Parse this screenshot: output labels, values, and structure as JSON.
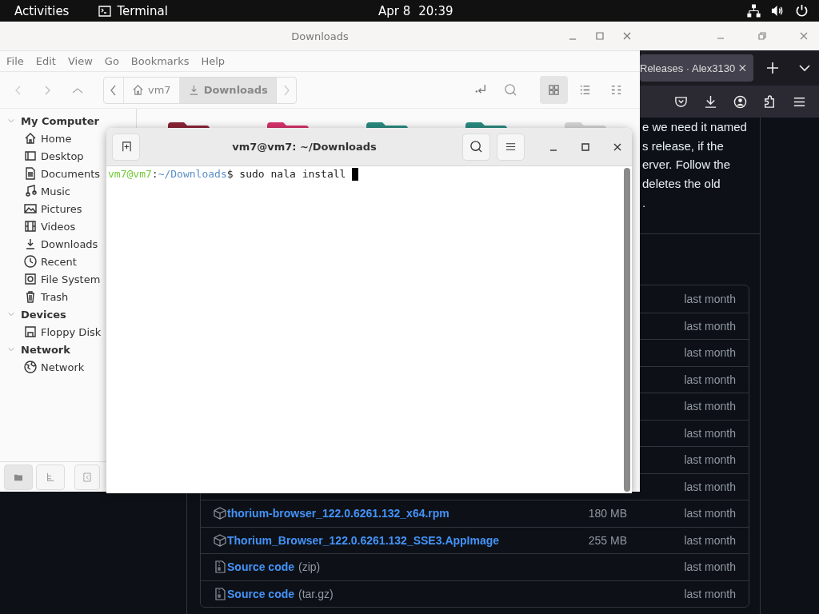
{
  "top_bar": {
    "activities": "Activities",
    "app": "Terminal",
    "date": "Apr 8",
    "time": "20:39"
  },
  "browser": {
    "tabs": [
      {
        "title": "Releases · Alex3130",
        "selected": true
      }
    ],
    "description_lines": [
      "e we need it named",
      "s release, if the",
      "erver. Follow the",
      "deletes the old",
      "."
    ],
    "assets": [
      {
        "date": "last month"
      },
      {
        "date": "last month"
      },
      {
        "date": "last month"
      },
      {
        "date": "last month"
      },
      {
        "date": "last month"
      },
      {
        "date": "last month"
      },
      {
        "date": "last month"
      },
      {
        "date": "last month"
      },
      {
        "kind": "package",
        "name": "thorium-browser_122.0.6261.132_x64.rpm",
        "size": "180 MB",
        "date": "last month"
      },
      {
        "kind": "package",
        "name": "Thorium_Browser_122.0.6261.132_SSE3.AppImage",
        "size": "255 MB",
        "date": "last month"
      },
      {
        "kind": "source",
        "name": "Source code",
        "ext": "(zip)",
        "date": "last month"
      },
      {
        "kind": "source",
        "name": "Source code",
        "ext": "(tar.gz)",
        "date": "last month"
      }
    ]
  },
  "file_manager": {
    "title": "Downloads",
    "menu": [
      "File",
      "Edit",
      "View",
      "Go",
      "Bookmarks",
      "Help"
    ],
    "path": [
      {
        "label": "vm7",
        "kind": "home",
        "selected": false
      },
      {
        "label": "Downloads",
        "kind": "downloads",
        "selected": true
      }
    ],
    "views": [
      {
        "kind": "grid",
        "selected": true
      },
      {
        "kind": "list",
        "selected": false
      },
      {
        "kind": "compact",
        "selected": false
      }
    ],
    "sidebar": [
      {
        "label": "My Computer",
        "expanded": true,
        "children": [
          {
            "label": "Home",
            "kind": "home"
          },
          {
            "label": "Desktop",
            "kind": "desktop"
          },
          {
            "label": "Documents",
            "kind": "documents"
          },
          {
            "label": "Music",
            "kind": "music"
          },
          {
            "label": "Pictures",
            "kind": "pictures"
          },
          {
            "label": "Videos",
            "kind": "videos"
          },
          {
            "label": "Downloads",
            "kind": "downloads"
          },
          {
            "label": "Recent",
            "kind": "recent"
          },
          {
            "label": "File System",
            "kind": "filesystem"
          },
          {
            "label": "Trash",
            "kind": "trash"
          }
        ]
      },
      {
        "label": "Devices",
        "expanded": true,
        "children": [
          {
            "label": "Floppy Disk",
            "kind": "floppy"
          }
        ]
      },
      {
        "label": "Network",
        "expanded": true,
        "children": [
          {
            "label": "Network",
            "kind": "network"
          }
        ]
      }
    ],
    "folders": [
      {
        "color": "#8a2435"
      },
      {
        "color": "#d6336c"
      },
      {
        "color": "#2a8a80"
      },
      {
        "color": "#2a8a80"
      },
      {
        "color": "#d4d4d4"
      }
    ]
  },
  "terminal": {
    "title": "vm7@vm7: ~/Downloads",
    "user_host": "vm7@vm7",
    "separator": ":",
    "path": "~/Downloads",
    "symbol": "$",
    "command": "sudo nala install"
  }
}
